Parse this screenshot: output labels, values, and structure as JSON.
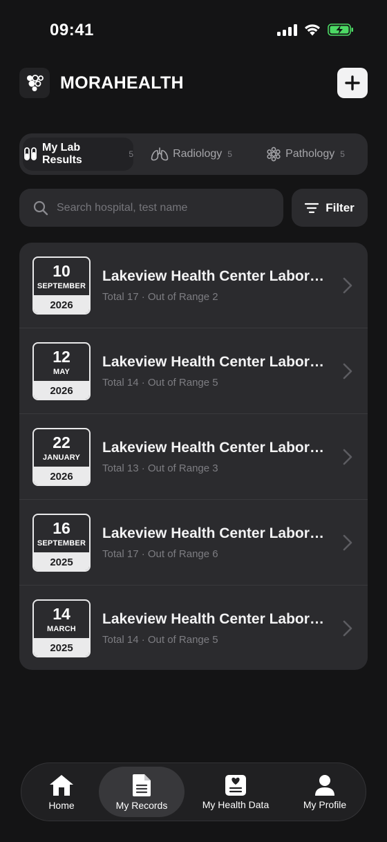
{
  "status_bar": {
    "time": "09:41"
  },
  "header": {
    "app_name": "MORAHEALTH"
  },
  "tabs": [
    {
      "label": "My Lab Results",
      "count": "5",
      "icon": "test-tubes-icon",
      "active": true
    },
    {
      "label": "Radiology",
      "count": "5",
      "icon": "lungs-icon",
      "active": false
    },
    {
      "label": "Pathology",
      "count": "5",
      "icon": "cells-icon",
      "active": false
    }
  ],
  "search": {
    "placeholder": "Search hospital, test name",
    "value": ""
  },
  "filter": {
    "label": "Filter"
  },
  "records": [
    {
      "day": "10",
      "month": "SEPTEMBER",
      "year": "2026",
      "title": "Lakeview Health Center Laboratory",
      "summary": "Total 17 · Out of Range 2"
    },
    {
      "day": "12",
      "month": "MAY",
      "year": "2026",
      "title": "Lakeview Health Center Laboratory",
      "summary": "Total 14 · Out of Range 5"
    },
    {
      "day": "22",
      "month": "JANUARY",
      "year": "2026",
      "title": "Lakeview Health Center Laboratory",
      "summary": "Total 13 · Out of Range 3"
    },
    {
      "day": "16",
      "month": "SEPTEMBER",
      "year": "2025",
      "title": "Lakeview Health Center Laboratory",
      "summary": "Total 17 · Out of Range 6"
    },
    {
      "day": "14",
      "month": "MARCH",
      "year": "2025",
      "title": "Lakeview Health Center Laboratory",
      "summary": "Total 14 · Out of Range 5"
    }
  ],
  "bottom_nav": [
    {
      "label": "Home",
      "icon": "home-icon",
      "active": false
    },
    {
      "label": "My Records",
      "icon": "document-icon",
      "active": true
    },
    {
      "label": "My Health Data",
      "icon": "health-card-icon",
      "active": false
    },
    {
      "label": "My Profile",
      "icon": "person-icon",
      "active": false
    }
  ],
  "colors": {
    "background": "#141415",
    "surface": "#2b2b2e",
    "battery_accent": "#4cd964"
  }
}
